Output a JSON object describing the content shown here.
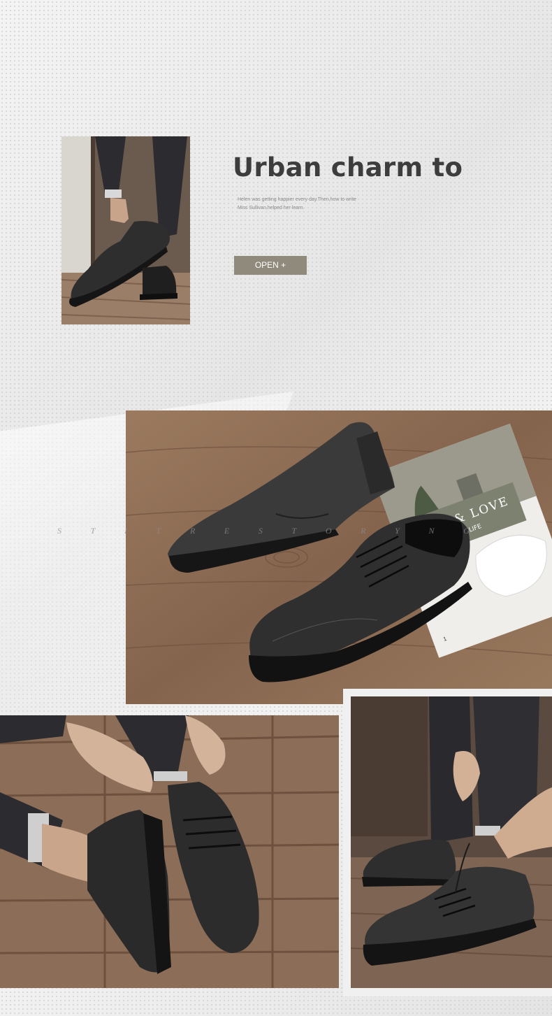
{
  "hero": {
    "headline": "Urban charm to",
    "description_lines": [
      "Helen was getting happier every day.Then,how to write",
      "Miss Sullivan,helped her learn."
    ],
    "open_button": "OPEN +"
  },
  "watermark": [
    "S",
    "T",
    "I",
    "T",
    "R",
    "E",
    "S",
    "T",
    "O",
    "R",
    "Y",
    "N",
    "G"
  ],
  "magazine": {
    "line1": "LIVE & LOVE",
    "line2": "ENJOY YOUR LIFE",
    "page_number": "1"
  },
  "colors": {
    "button": "#8f8a7c",
    "headline": "#3d3d3d",
    "shoe": "#2a2a2a",
    "wood": "#8b6a52"
  }
}
